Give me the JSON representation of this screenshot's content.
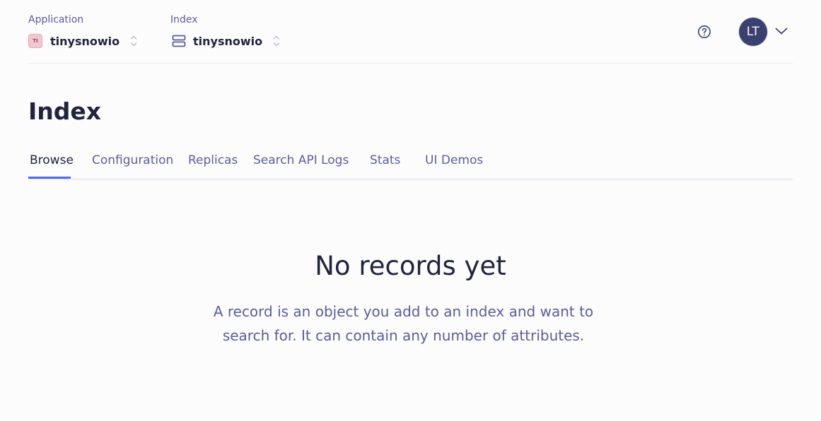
{
  "header": {
    "application": {
      "label": "Application",
      "badge_text": "TI",
      "value": "tinysnowio"
    },
    "index": {
      "label": "Index",
      "value": "tinysnowio"
    },
    "help_icon": "question-circle-icon",
    "avatar_initials": "LT"
  },
  "page": {
    "title": "Index"
  },
  "tabs": [
    {
      "label": "Browse",
      "active": true
    },
    {
      "label": "Configuration",
      "active": false
    },
    {
      "label": "Replicas",
      "active": false
    },
    {
      "label": "Search API Logs",
      "active": false
    },
    {
      "label": "Stats",
      "active": false
    },
    {
      "label": "UI Demos",
      "active": false
    }
  ],
  "empty_state": {
    "title": "No records yet",
    "description": "A record is an object you add to an index and want to search for. It can contain any number of attributes."
  },
  "colors": {
    "accent": "#5468ff",
    "text_primary": "#21243d",
    "text_secondary": "#5a5e9a",
    "avatar_bg": "#3a416f"
  }
}
